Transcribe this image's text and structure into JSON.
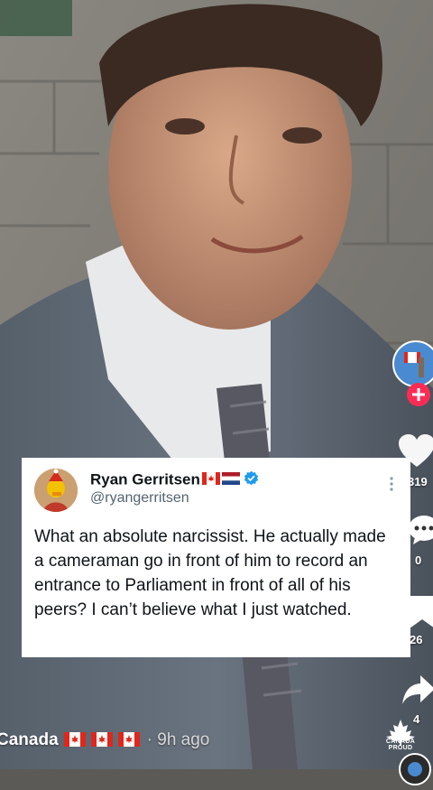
{
  "post": {
    "author_name": "Ryan Gerritsen",
    "handle": "@ryangerritsen",
    "more_icon": "more-vertical-icon",
    "text": "What an absolute narcissist. He actually made a cameraman go in front of him to record an entrance to Parliament in front of all of his peers? I can’t believe what I just watched."
  },
  "sidebar": {
    "like_count": "319",
    "comment_count": "0",
    "save_count": "26",
    "share_count": "4"
  },
  "caption": {
    "text": "Canada",
    "time": "· 9h ago"
  },
  "watermark": {
    "text": "CANADA PROUD"
  },
  "colors": {
    "verified": "#1d9bf0",
    "follow_plus": "#fe2c55",
    "canada_red": "#e1261c"
  }
}
